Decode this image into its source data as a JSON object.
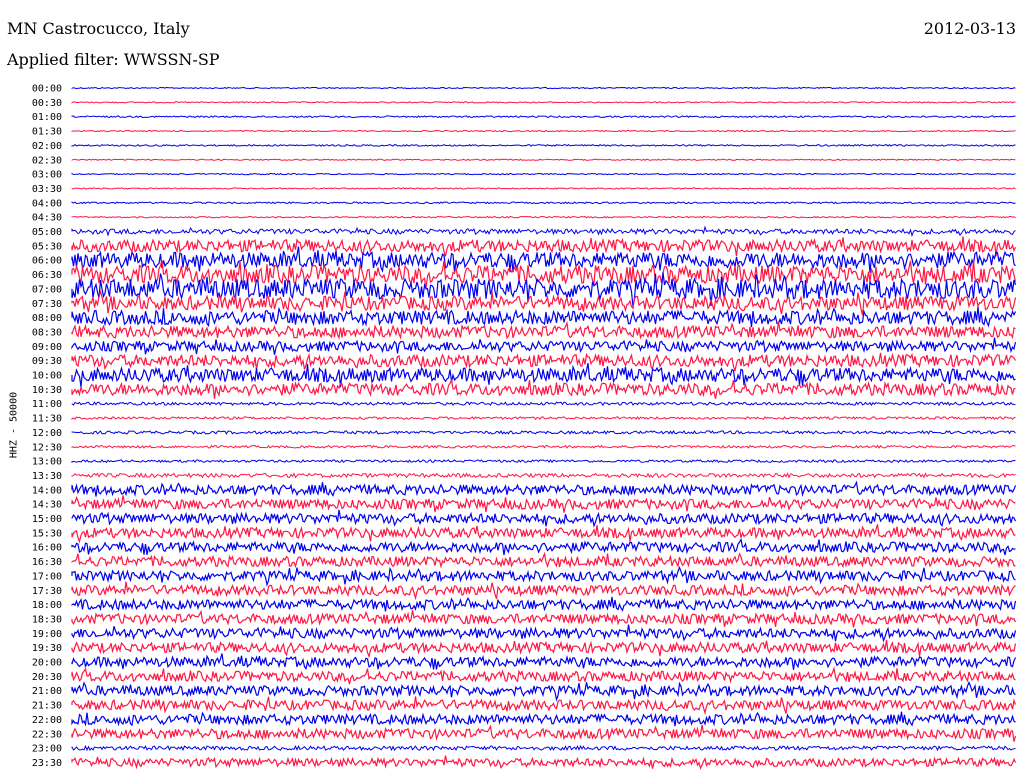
{
  "header": {
    "station": "MN Castrocucco, Italy",
    "date": "2012-03-13",
    "filter_label": "Applied filter: WWSSN-SP"
  },
  "chart_data": {
    "type": "line",
    "ylabel": "HHZ - 50000",
    "colors": {
      "odd_rows": "#0000ee",
      "even_rows": "#ff1744"
    },
    "rows": [
      {
        "label": "00:00",
        "amp": 0.6
      },
      {
        "label": "00:30",
        "amp": 0.6
      },
      {
        "label": "01:00",
        "amp": 0.8
      },
      {
        "label": "01:30",
        "amp": 0.6
      },
      {
        "label": "02:00",
        "amp": 0.8
      },
      {
        "label": "02:30",
        "amp": 0.6
      },
      {
        "label": "03:00",
        "amp": 0.6
      },
      {
        "label": "03:30",
        "amp": 0.6
      },
      {
        "label": "04:00",
        "amp": 0.8
      },
      {
        "label": "04:30",
        "amp": 0.7
      },
      {
        "label": "05:00",
        "amp": 2.5
      },
      {
        "label": "05:30",
        "amp": 6
      },
      {
        "label": "06:00",
        "amp": 8
      },
      {
        "label": "06:30",
        "amp": 9
      },
      {
        "label": "07:00",
        "amp": 10
      },
      {
        "label": "07:30",
        "amp": 7
      },
      {
        "label": "08:00",
        "amp": 7
      },
      {
        "label": "08:30",
        "amp": 6
      },
      {
        "label": "09:00",
        "amp": 5
      },
      {
        "label": "09:30",
        "amp": 6
      },
      {
        "label": "10:00",
        "amp": 7
      },
      {
        "label": "10:30",
        "amp": 6
      },
      {
        "label": "11:00",
        "amp": 1.5
      },
      {
        "label": "11:30",
        "amp": 1.2
      },
      {
        "label": "12:00",
        "amp": 1.5
      },
      {
        "label": "12:30",
        "amp": 1.2
      },
      {
        "label": "13:00",
        "amp": 1.2
      },
      {
        "label": "13:30",
        "amp": 2
      },
      {
        "label": "14:00",
        "amp": 5
      },
      {
        "label": "14:30",
        "amp": 5
      },
      {
        "label": "15:00",
        "amp": 5
      },
      {
        "label": "15:30",
        "amp": 5
      },
      {
        "label": "16:00",
        "amp": 5
      },
      {
        "label": "16:30",
        "amp": 5
      },
      {
        "label": "17:00",
        "amp": 5
      },
      {
        "label": "17:30",
        "amp": 5
      },
      {
        "label": "18:00",
        "amp": 5
      },
      {
        "label": "18:30",
        "amp": 5
      },
      {
        "label": "19:00",
        "amp": 5
      },
      {
        "label": "19:30",
        "amp": 5
      },
      {
        "label": "20:00",
        "amp": 5
      },
      {
        "label": "20:30",
        "amp": 5
      },
      {
        "label": "21:00",
        "amp": 5
      },
      {
        "label": "21:30",
        "amp": 5
      },
      {
        "label": "22:00",
        "amp": 5
      },
      {
        "label": "22:30",
        "amp": 5
      },
      {
        "label": "23:00",
        "amp": 2
      },
      {
        "label": "23:30",
        "amp": 4
      }
    ]
  }
}
